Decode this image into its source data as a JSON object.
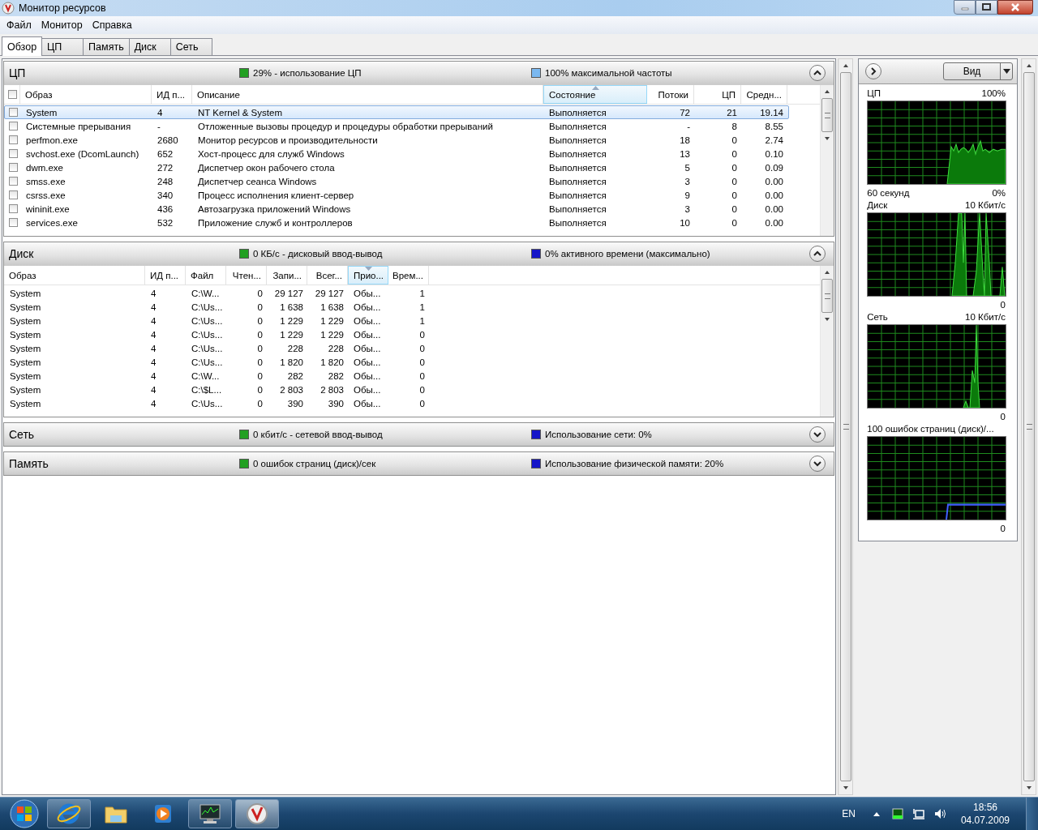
{
  "window": {
    "title": "Монитор ресурсов"
  },
  "menu": [
    "Файл",
    "Монитор",
    "Справка"
  ],
  "tabs": [
    {
      "label": "Обзор",
      "selected": true
    },
    {
      "label": "ЦП",
      "selected": false
    },
    {
      "label": "Память",
      "selected": false
    },
    {
      "label": "Диск",
      "selected": false
    },
    {
      "label": "Сеть",
      "selected": false
    }
  ],
  "sections": [
    {
      "title": "ЦП",
      "expanded": true,
      "legends": [
        {
          "text": "29% - использование ЦП",
          "color": "#22a022"
        },
        {
          "text": "100% максимальной частоты",
          "color": "#7ab8f0"
        }
      ],
      "table": {
        "kind": "checklist",
        "all_checked": false,
        "columns": [
          {
            "label": "Образ",
            "kind": "text",
            "sorted": false
          },
          {
            "label": "ИД п...",
            "kind": "text",
            "sorted": false
          },
          {
            "label": "Описание",
            "kind": "text",
            "sorted": false
          },
          {
            "label": "Состояние",
            "kind": "text",
            "sorted": true,
            "descending": false
          },
          {
            "label": "Потоки",
            "kind": "number",
            "sorted": false
          },
          {
            "label": "ЦП",
            "kind": "number",
            "sorted": false
          },
          {
            "label": "Средн...",
            "kind": "number",
            "sorted": false
          }
        ],
        "rows": [
          {
            "checked": false,
            "selected": true,
            "cells": [
              "System",
              "4",
              "NT Kernel & System",
              "Выполняется",
              "72",
              "21",
              "19.14"
            ]
          },
          {
            "checked": false,
            "selected": false,
            "cells": [
              "Системные прерывания",
              "-",
              "Отложенные вызовы процедур и процедуры обработки прерываний",
              "Выполняется",
              "-",
              "8",
              "8.55"
            ]
          },
          {
            "checked": false,
            "selected": false,
            "cells": [
              "perfmon.exe",
              "2680",
              "Монитор ресурсов и производительности",
              "Выполняется",
              "18",
              "0",
              "2.74"
            ]
          },
          {
            "checked": false,
            "selected": false,
            "cells": [
              "svchost.exe (DcomLaunch)",
              "652",
              "Хост-процесс для служб Windows",
              "Выполняется",
              "13",
              "0",
              "0.10"
            ]
          },
          {
            "checked": false,
            "selected": false,
            "cells": [
              "dwm.exe",
              "272",
              "Диспетчер окон рабочего стола",
              "Выполняется",
              "5",
              "0",
              "0.09"
            ]
          },
          {
            "checked": false,
            "selected": false,
            "cells": [
              "smss.exe",
              "248",
              "Диспетчер сеанса  Windows",
              "Выполняется",
              "3",
              "0",
              "0.00"
            ]
          },
          {
            "checked": false,
            "selected": false,
            "cells": [
              "csrss.exe",
              "340",
              "Процесс исполнения клиент-сервер",
              "Выполняется",
              "9",
              "0",
              "0.00"
            ]
          },
          {
            "checked": false,
            "selected": false,
            "cells": [
              "wininit.exe",
              "436",
              "Автозагрузка приложений Windows",
              "Выполняется",
              "3",
              "0",
              "0.00"
            ]
          },
          {
            "checked": false,
            "selected": false,
            "cells": [
              "services.exe",
              "532",
              "Приложение служб и контроллеров",
              "Выполняется",
              "10",
              "0",
              "0.00"
            ]
          }
        ]
      }
    },
    {
      "title": "Диск",
      "expanded": true,
      "legends": [
        {
          "text": "0 КБ/с - дисковый ввод-вывод",
          "color": "#22a022"
        },
        {
          "text": "0% активного времени (максимально)",
          "color": "#1414c8"
        }
      ],
      "table": {
        "kind": "plain",
        "columns": [
          {
            "label": "Образ",
            "kind": "text",
            "sorted": false
          },
          {
            "label": "ИД п...",
            "kind": "text",
            "sorted": false
          },
          {
            "label": "Файл",
            "kind": "text",
            "sorted": false
          },
          {
            "label": "Чтен...",
            "kind": "number",
            "sorted": false
          },
          {
            "label": "Запи...",
            "kind": "number",
            "sorted": false
          },
          {
            "label": "Всег...",
            "kind": "number",
            "sorted": false
          },
          {
            "label": "Прио...",
            "kind": "text",
            "sorted": true,
            "descending": true
          },
          {
            "label": "Врем...",
            "kind": "number",
            "sorted": false
          }
        ],
        "rows": [
          {
            "selected": false,
            "cells": [
              "System",
              "4",
              "C:\\W...",
              "0",
              "29 127",
              "29 127",
              "Обы...",
              "1"
            ]
          },
          {
            "selected": false,
            "cells": [
              "System",
              "4",
              "C:\\Us...",
              "0",
              "1 638",
              "1 638",
              "Обы...",
              "1"
            ]
          },
          {
            "selected": false,
            "cells": [
              "System",
              "4",
              "C:\\Us...",
              "0",
              "1 229",
              "1 229",
              "Обы...",
              "1"
            ]
          },
          {
            "selected": false,
            "cells": [
              "System",
              "4",
              "C:\\Us...",
              "0",
              "1 229",
              "1 229",
              "Обы...",
              "0"
            ]
          },
          {
            "selected": false,
            "cells": [
              "System",
              "4",
              "C:\\Us...",
              "0",
              "228",
              "228",
              "Обы...",
              "0"
            ]
          },
          {
            "selected": false,
            "cells": [
              "System",
              "4",
              "C:\\Us...",
              "0",
              "1 820",
              "1 820",
              "Обы...",
              "0"
            ]
          },
          {
            "selected": false,
            "cells": [
              "System",
              "4",
              "C:\\W...",
              "0",
              "282",
              "282",
              "Обы...",
              "0"
            ]
          },
          {
            "selected": false,
            "cells": [
              "System",
              "4",
              "C:\\$L...",
              "0",
              "2 803",
              "2 803",
              "Обы...",
              "0"
            ]
          },
          {
            "selected": false,
            "cells": [
              "System",
              "4",
              "C:\\Us...",
              "0",
              "390",
              "390",
              "Обы...",
              "0"
            ]
          }
        ]
      }
    },
    {
      "title": "Сеть",
      "expanded": false,
      "legends": [
        {
          "text": "0 кбит/с - сетевой ввод-вывод",
          "color": "#22a022"
        },
        {
          "text": "Использование сети: 0%",
          "color": "#1414c8"
        }
      ]
    },
    {
      "title": "Память",
      "expanded": false,
      "legends": [
        {
          "text": "0 ошибок страниц (диск)/сек",
          "color": "#22a022"
        },
        {
          "text": "Использование физической памяти: 20%",
          "color": "#1414c8"
        }
      ]
    }
  ],
  "side": {
    "view_button": "Вид",
    "graphs": [
      {
        "kind": "cpu",
        "title": "ЦП",
        "max": "100%",
        "span": "60 секунд",
        "min": "0%"
      },
      {
        "kind": "disk",
        "title": "Диск",
        "max": "10 Кбит/с",
        "min": "0"
      },
      {
        "kind": "network",
        "title": "Сеть",
        "max": "10 Кбит/с",
        "min": "0"
      },
      {
        "kind": "faults",
        "title": "100 ошибок страниц (диск)/...",
        "min": "0"
      }
    ]
  },
  "taskbar": {
    "apps": [
      {
        "kind": "browser",
        "running": true,
        "active": false
      },
      {
        "kind": "folder",
        "running": false,
        "active": false
      },
      {
        "kind": "media",
        "running": false,
        "active": false
      },
      {
        "kind": "monitor",
        "running": true,
        "active": false
      },
      {
        "kind": "gauge",
        "running": true,
        "active": true
      }
    ],
    "language": "EN",
    "time": "18:56",
    "date": "04.07.2009"
  }
}
